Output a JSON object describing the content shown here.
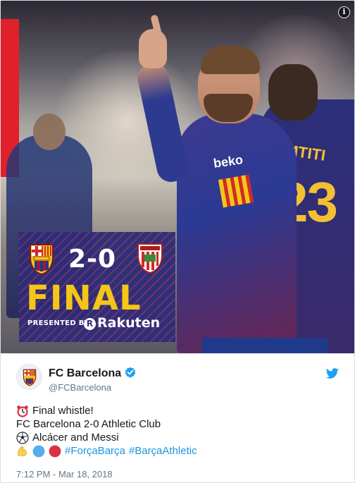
{
  "media": {
    "info_label": "i",
    "result_graphic": {
      "score": "2-0",
      "final_label": "FINAL",
      "presented_by": "PRESENTED BY",
      "sponsor": "Rakuten",
      "sponsor_mark": "R"
    }
  },
  "tweet": {
    "display_name": "FC Barcelona",
    "handle": "@FCBarcelona",
    "verified": true,
    "lines": [
      {
        "icon": "alarm-clock-emoji",
        "text": "Final whistle!"
      },
      {
        "icon": null,
        "text": "FC Barcelona 2-0 Athletic Club"
      },
      {
        "icon": "soccer-ball-emoji",
        "text": "Alcácer and Messi"
      }
    ],
    "reaction_emojis": [
      "flexed-biceps-emoji",
      "blue-circle-emoji",
      "red-circle-emoji"
    ],
    "hashtags": [
      "#ForçaBarça",
      "#BarçaAthletic"
    ],
    "timestamp": "7:12 PM - Mar 18, 2018"
  },
  "colors": {
    "hashtag_blue": "#1b95e0",
    "twitter_blue": "#1da1f2",
    "final_yellow": "#f5c518",
    "handle_gray": "#657786"
  }
}
